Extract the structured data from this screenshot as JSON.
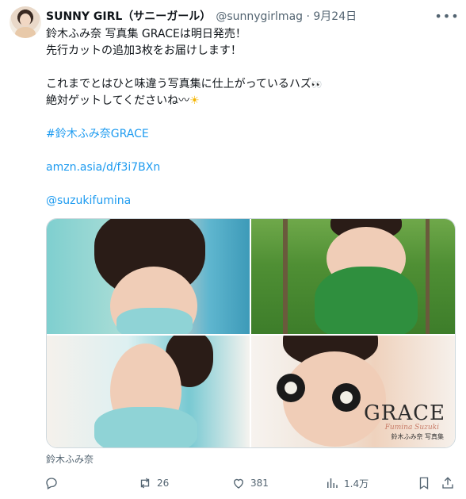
{
  "author": {
    "name": "SUNNY GIRL（サニーガール）",
    "handle": "@sunnygirlmag · 9月24日"
  },
  "tweet": {
    "line1": "鈴木ふみ奈 写真集 GRACEは明日発売！",
    "line2": "先行カットの追加3枚をお届けします！",
    "line3": "これまでとはひと味違う写真集に仕上がっているハズ",
    "line3_emoji": "👀",
    "line4": "絶対ゲットしてくださいね〰",
    "line4_emoji": "☀",
    "hashtag": "#鈴木ふみ奈GRACE",
    "url": "amzn.asia/d/f3i7BXn",
    "mention": "@suzukifumina"
  },
  "media": {
    "cover_title": "GRACE",
    "cover_signature": "Fumina Suzuki",
    "cover_subtitle": "鈴木ふみ奈  写真集"
  },
  "caption": "鈴木ふみ奈",
  "actions": {
    "reply_count": "",
    "retweet_count": "26",
    "like_count": "381",
    "view_count": "1.4万"
  },
  "colors": {
    "link": "#1d9bf0",
    "secondary_text": "#536471",
    "border": "#cfd9de"
  }
}
